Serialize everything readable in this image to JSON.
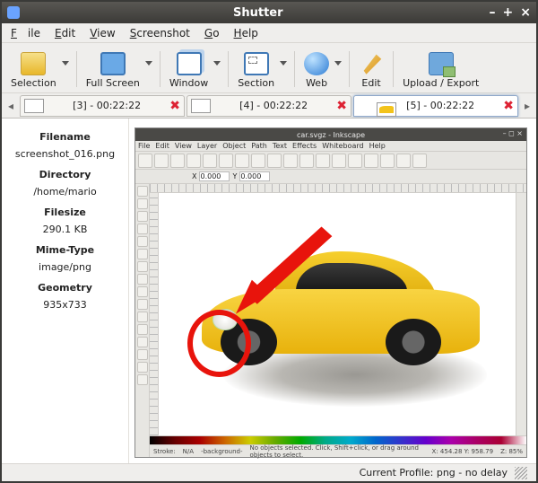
{
  "window": {
    "title": "Shutter"
  },
  "menu": {
    "file": "File",
    "edit": "Edit",
    "view": "View",
    "screenshot": "Screenshot",
    "go": "Go",
    "help": "Help"
  },
  "toolbar": {
    "selection": "Selection",
    "full_screen": "Full Screen",
    "window": "Window",
    "section": "Section",
    "web": "Web",
    "edit": "Edit",
    "upload_export": "Upload / Export"
  },
  "tabs": [
    {
      "label": "[3] - 00:22:22"
    },
    {
      "label": "[4] - 00:22:22"
    },
    {
      "label": "[5] - 00:22:22"
    }
  ],
  "properties": {
    "filename_h": "Filename",
    "filename_v": "screenshot_016.png",
    "directory_h": "Directory",
    "directory_v": "/home/mario",
    "filesize_h": "Filesize",
    "filesize_v": "290.1 KB",
    "mimetype_h": "Mime-Type",
    "mimetype_v": "image/png",
    "geometry_h": "Geometry",
    "geometry_v": "935x733"
  },
  "inkscape": {
    "title": "car.svgz - Inkscape",
    "menu": [
      "File",
      "Edit",
      "View",
      "Layer",
      "Object",
      "Path",
      "Text",
      "Effects",
      "Whiteboard",
      "Help"
    ],
    "coord_x": "0.000",
    "coord_y": "0.000",
    "status": "No objects selected. Click, Shift+click, or drag around objects to select.",
    "stroke_label": "Stroke:",
    "na1": "N/A",
    "na2": "N/A",
    "bg_label": "-background-",
    "coord_right": "X: 454.28  Y: 958.79",
    "zoom": "Z: 85%"
  },
  "statusbar": {
    "text": "Current Profile: png - no delay"
  }
}
